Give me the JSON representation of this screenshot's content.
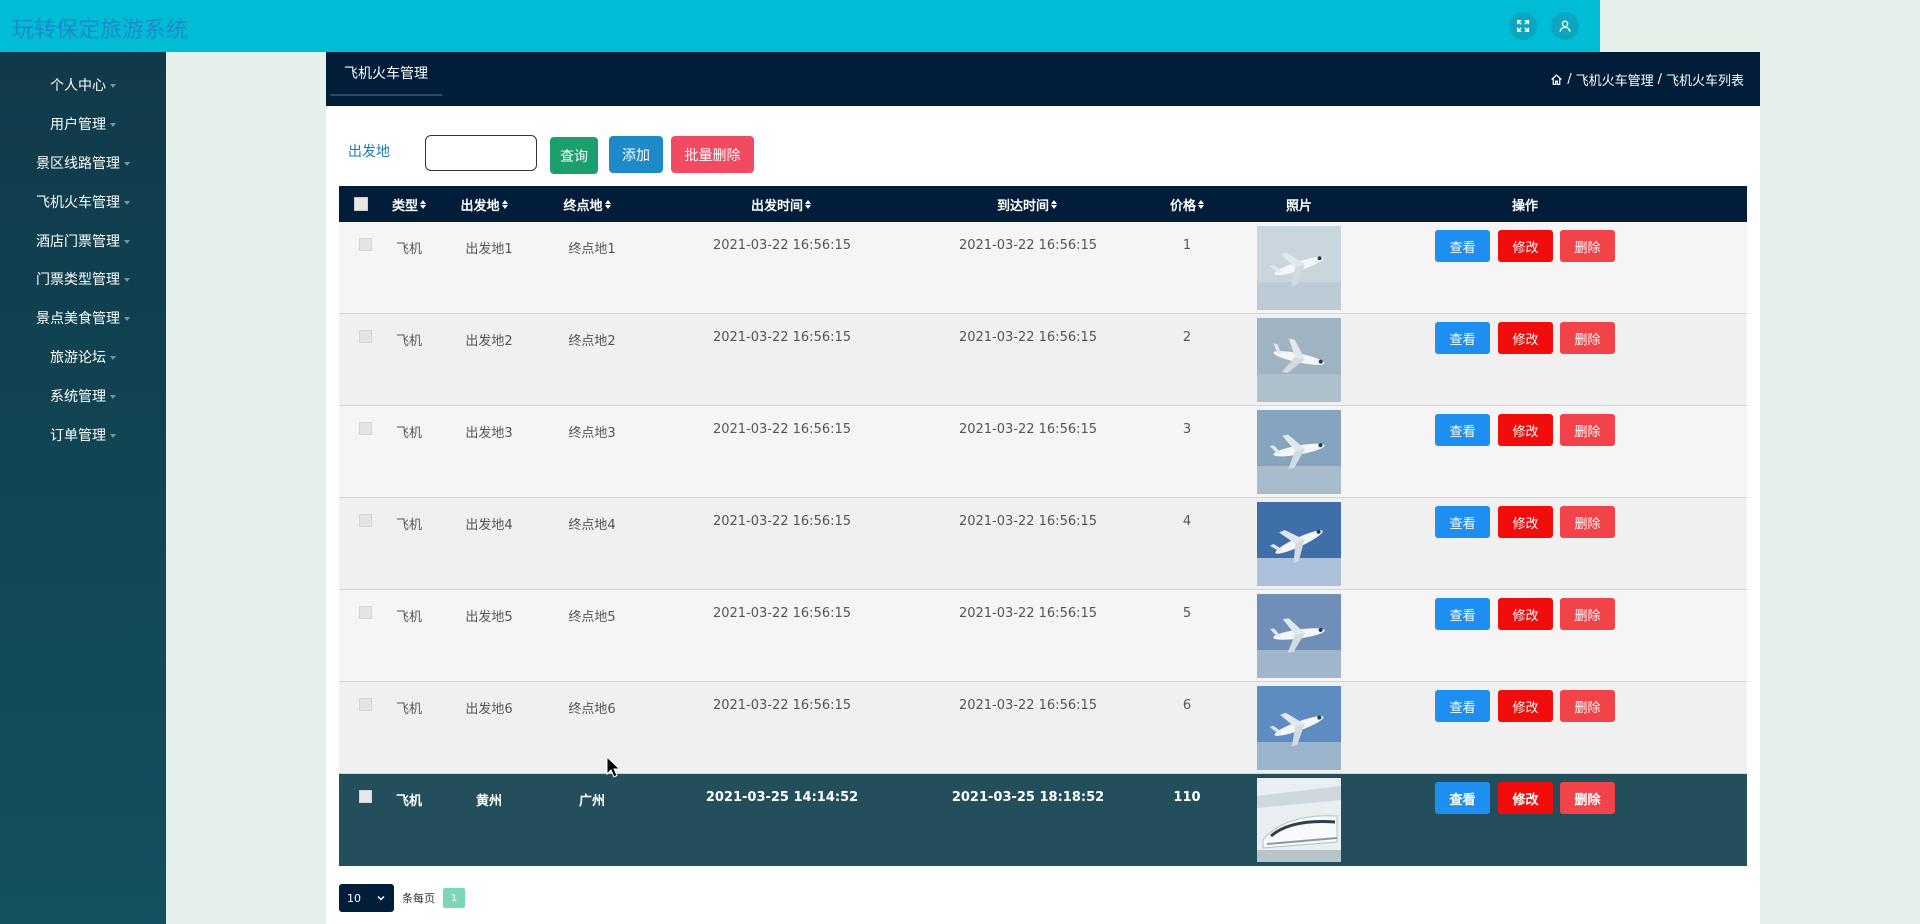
{
  "header": {
    "app_title": "玩转保定旅游系统",
    "icons": [
      "fullscreen-icon",
      "user-icon"
    ]
  },
  "sidebar": {
    "items": [
      {
        "label": "个人中心"
      },
      {
        "label": "用户管理"
      },
      {
        "label": "景区线路管理"
      },
      {
        "label": "飞机火车管理"
      },
      {
        "label": "酒店门票管理"
      },
      {
        "label": "门票类型管理"
      },
      {
        "label": "景点美食管理"
      },
      {
        "label": "旅游论坛"
      },
      {
        "label": "系统管理"
      },
      {
        "label": "订单管理"
      }
    ]
  },
  "main": {
    "tab_title": "飞机火车管理",
    "breadcrumb": [
      "飞机火车管理",
      "飞机火车列表"
    ],
    "breadcrumb_separator": "/"
  },
  "search": {
    "label": "出发地",
    "value": "",
    "query_label": "查询",
    "add_label": "添加",
    "batch_delete_label": "批量删除"
  },
  "table": {
    "columns": [
      "类型",
      "出发地",
      "终点地",
      "出发时间",
      "到达时间",
      "价格",
      "照片",
      "操作"
    ],
    "rows": [
      {
        "type": "飞机",
        "from": "出发地1",
        "to": "终点地1",
        "depart": "2021-03-22 16:56:15",
        "arrive": "2021-03-22 16:56:15",
        "price": "1",
        "photo": "airplane"
      },
      {
        "type": "飞机",
        "from": "出发地2",
        "to": "终点地2",
        "depart": "2021-03-22 16:56:15",
        "arrive": "2021-03-22 16:56:15",
        "price": "2",
        "photo": "airplane"
      },
      {
        "type": "飞机",
        "from": "出发地3",
        "to": "终点地3",
        "depart": "2021-03-22 16:56:15",
        "arrive": "2021-03-22 16:56:15",
        "price": "3",
        "photo": "airplane"
      },
      {
        "type": "飞机",
        "from": "出发地4",
        "to": "终点地4",
        "depart": "2021-03-22 16:56:15",
        "arrive": "2021-03-22 16:56:15",
        "price": "4",
        "photo": "airplane"
      },
      {
        "type": "飞机",
        "from": "出发地5",
        "to": "终点地5",
        "depart": "2021-03-22 16:56:15",
        "arrive": "2021-03-22 16:56:15",
        "price": "5",
        "photo": "airplane"
      },
      {
        "type": "飞机",
        "from": "出发地6",
        "to": "终点地6",
        "depart": "2021-03-22 16:56:15",
        "arrive": "2021-03-22 16:56:15",
        "price": "6",
        "photo": "airplane"
      },
      {
        "type": "飞机",
        "from": "黄州",
        "to": "广州",
        "depart": "2021-03-25 14:14:52",
        "arrive": "2021-03-25 18:18:52",
        "price": "110",
        "photo": "train"
      }
    ],
    "actions": {
      "view": "查看",
      "edit": "修改",
      "delete": "删除"
    }
  },
  "pagination": {
    "page_size": "10",
    "per_page_label": "条每页",
    "current_page": "1"
  },
  "colors": {
    "topbar": "#00bcd4",
    "sidebar": "#0f3a4a",
    "header_dark": "#011d3a",
    "highlight_row": "#234f5d",
    "view_button": "#1e8ff0",
    "edit_button": "#f20d0d",
    "delete_button": "#f2434a"
  }
}
